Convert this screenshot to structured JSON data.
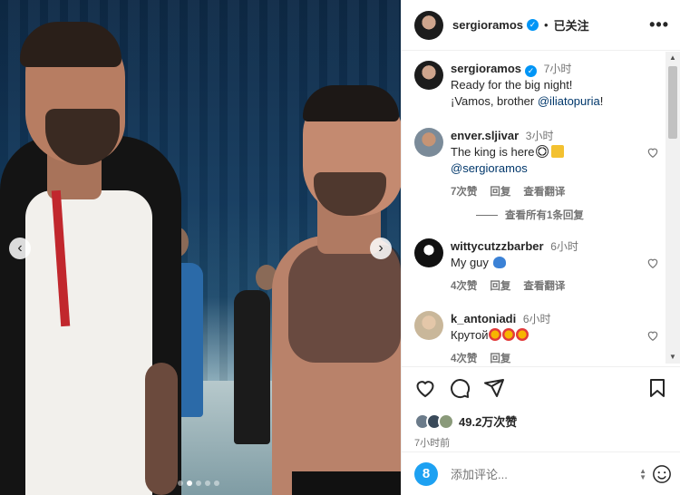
{
  "post": {
    "author": "sergioramos",
    "follow_status": "已关注",
    "more_label": "•••"
  },
  "caption": {
    "username": "sergioramos",
    "time": "7小时",
    "line1": "Ready for the big night!",
    "line2_prefix": "¡Vamos, brother ",
    "line2_mention": "@iliatopuria",
    "line2_suffix": "!"
  },
  "comments": [
    {
      "username": "enver.sljivar",
      "time": "3小时",
      "text": "The king is here",
      "emojis": [
        "soccer-ball-emoji",
        "crown-emoji"
      ],
      "mention": "@sergioramos",
      "likes": "7次赞",
      "reply": "回复",
      "translate": "查看翻译",
      "view_replies": "查看所有1条回复"
    },
    {
      "username": "wittycutzzbarber",
      "time": "6小时",
      "text": "My guy",
      "emojis": [
        "blue-heart-emoji"
      ],
      "likes": "4次赞",
      "reply": "回复",
      "translate": "查看翻译"
    },
    {
      "username": "k_antoniadi",
      "time": "6小时",
      "text": "Крутой",
      "emojis": [
        "star-struck-emoji",
        "star-struck-emoji",
        "star-struck-emoji"
      ],
      "likes": "4次赞",
      "reply": "回复"
    }
  ],
  "stats": {
    "like_count": "49.2万次赞",
    "post_time": "7小时前"
  },
  "compose": {
    "placeholder": "添加评论...",
    "avatar_letter": "8"
  },
  "carousel": {
    "slide_count": 5,
    "active_index": 1
  },
  "colors": {
    "verified_blue": "#0095f6",
    "mention_blue": "#00376b",
    "muted_gray": "#737373"
  }
}
